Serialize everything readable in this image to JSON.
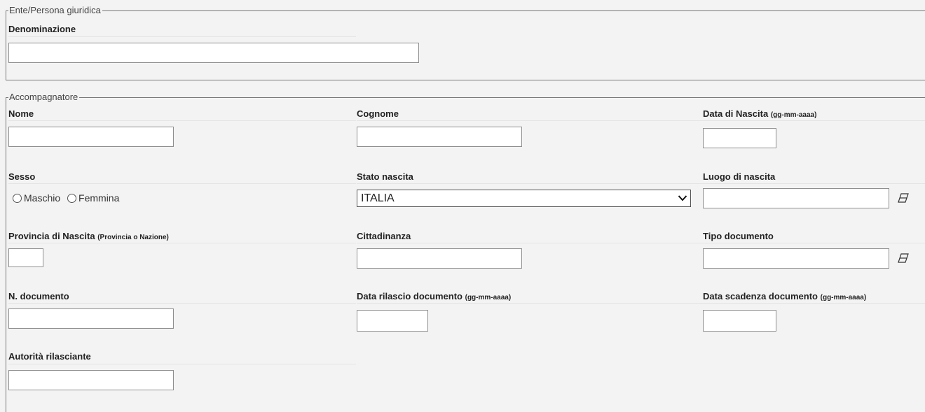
{
  "section_ente": {
    "legend": "Ente/Persona giuridica",
    "denominazione_label": "Denominazione",
    "denominazione_value": ""
  },
  "section_accompagnatore": {
    "legend": "Accompagnatore",
    "nome_label": "Nome",
    "cognome_label": "Cognome",
    "data_nascita_label": "Data di Nascita",
    "data_nascita_hint": "(gg-mm-aaaa)",
    "sesso_label": "Sesso",
    "sesso_options": [
      "Maschio",
      "Femmina"
    ],
    "stato_nascita_label": "Stato nascita",
    "stato_nascita_value": "ITALIA",
    "luogo_nascita_label": "Luogo di nascita",
    "provincia_label": "Provincia di Nascita",
    "provincia_hint": "(Provincia o Nazione)",
    "cittadinanza_label": "Cittadinanza",
    "tipo_documento_label": "Tipo documento",
    "n_documento_label": "N. documento",
    "data_rilascio_label": "Data rilascio documento",
    "data_rilascio_hint": "(gg-mm-aaaa)",
    "data_scadenza_label": "Data scadenza documento",
    "data_scadenza_hint": "(gg-mm-aaaa)",
    "autorita_label": "Autorità rilasciante"
  },
  "icons": {
    "eraser": "eraser-icon",
    "dropdown": "chevron-down-icon"
  }
}
